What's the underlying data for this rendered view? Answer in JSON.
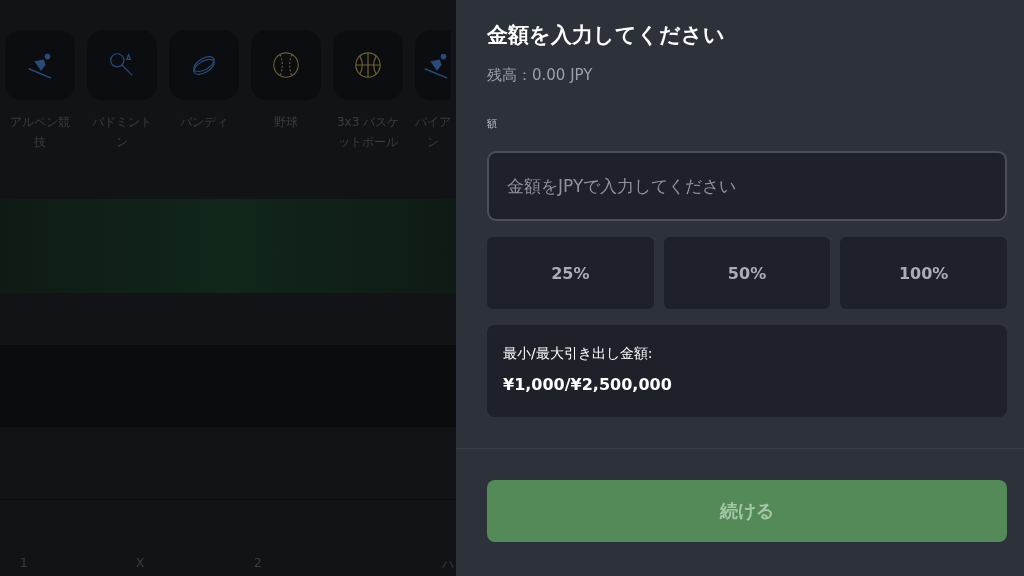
{
  "background": {
    "sports": [
      {
        "label": "アルペン競技",
        "kind": "skier"
      },
      {
        "label": "バドミントン",
        "kind": "racket"
      },
      {
        "label": "バンディ",
        "kind": "puck"
      },
      {
        "label": "野球",
        "kind": "baseball"
      },
      {
        "label": "3x3 バスケットボール",
        "kind": "basketball"
      },
      {
        "label": "バイアン",
        "kind": "skier"
      }
    ],
    "odds_labels": [
      "1",
      "X",
      "2",
      "ハ"
    ]
  },
  "panel": {
    "title": "金額を入力してください",
    "balance": "残高：0.00 JPY",
    "field_label": "額",
    "amount": {
      "placeholder": "金額をJPYで入力してください"
    },
    "presets": [
      "25%",
      "50%",
      "100%"
    ],
    "limits": {
      "label": "最小/最大引き出し金額:",
      "value": "¥1,000/¥2,500,000"
    },
    "continue": {
      "label": "続ける",
      "disabled": true
    }
  }
}
